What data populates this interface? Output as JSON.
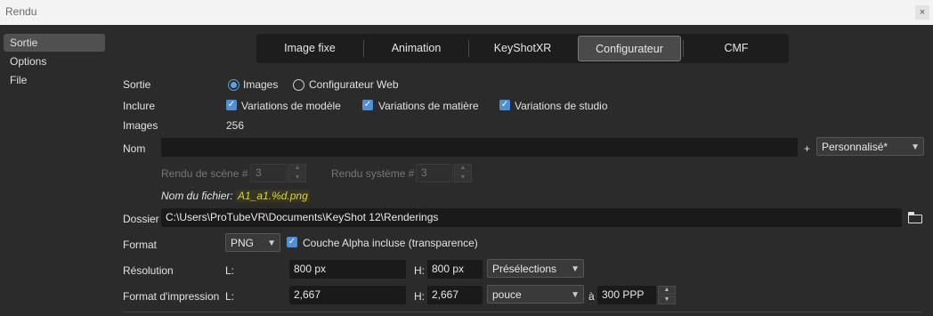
{
  "window": {
    "title": "Rendu",
    "close_glyph": "×"
  },
  "sidebar": {
    "items": [
      {
        "label": "Sortie"
      },
      {
        "label": "Options"
      },
      {
        "label": "File"
      }
    ]
  },
  "tabs": [
    {
      "label": "Image fixe"
    },
    {
      "label": "Animation"
    },
    {
      "label": "KeyShotXR"
    },
    {
      "label": "Configurateur"
    },
    {
      "label": "CMF"
    }
  ],
  "output": {
    "label": "Sortie",
    "images_option": "Images",
    "web_option": "Configurateur Web"
  },
  "include": {
    "label": "Inclure",
    "model_variations": "Variations de modèle",
    "material_variations": "Variations de matière",
    "studio_variations": "Variations de studio"
  },
  "images": {
    "label": "Images",
    "count": "256"
  },
  "name": {
    "label": "Nom",
    "value": "",
    "plus": "+",
    "preset": "Personnalisé*"
  },
  "scene_render": {
    "label": "Rendu de scène #",
    "value": "3"
  },
  "system_render": {
    "label": "Rendu système #",
    "value": "3"
  },
  "filename": {
    "label": "Nom du fichier:",
    "value": "A1_a1.%d.png"
  },
  "folder": {
    "label": "Dossier",
    "path": "C:\\Users\\ProTubeVR\\Documents\\KeyShot 12\\Renderings"
  },
  "format": {
    "label": "Format",
    "value": "PNG",
    "alpha_label": "Couche Alpha incluse (transparence)"
  },
  "resolution": {
    "label": "Résolution",
    "width_label": "L:",
    "width": "800 px",
    "height_label": "H:",
    "height": "800 px",
    "presets": "Présélections"
  },
  "print_format": {
    "label": "Format d'impression",
    "width_label": "L:",
    "width": "2,667",
    "height_label": "H:",
    "height": "2,667",
    "unit": "pouce",
    "at": "à",
    "dpi": "300 PPP"
  },
  "colors": {
    "accent": "#5aa0e6",
    "checkbox": "#4f8fd6",
    "highlight": "#d7d24a"
  },
  "icons": [
    "close-icon",
    "radio-icon",
    "checkbox-icon",
    "chevron-down-icon",
    "spinner-arrows-icon",
    "folder-icon"
  ]
}
